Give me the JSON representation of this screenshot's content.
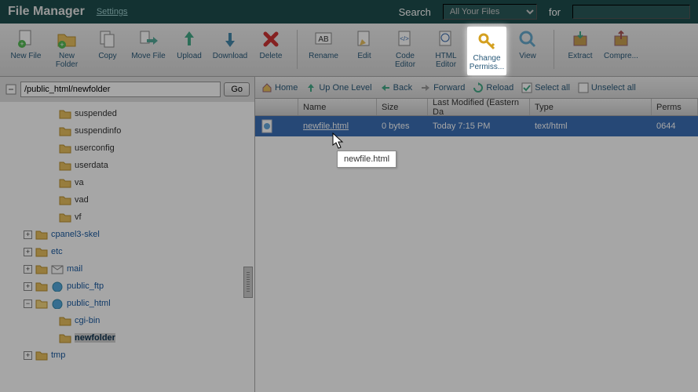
{
  "header": {
    "title": "File Manager",
    "settings": "Settings",
    "searchLabel": "Search",
    "searchScope": "All Your Files",
    "forLabel": "for"
  },
  "toolbar": {
    "newFile": "New File",
    "newFolder": "New Folder",
    "copy": "Copy",
    "moveFile": "Move File",
    "upload": "Upload",
    "download": "Download",
    "delete": "Delete",
    "rename": "Rename",
    "edit": "Edit",
    "codeEditor": "Code Editor",
    "htmlEditor": "HTML Editor",
    "changePerms": "Change Permiss...",
    "view": "View",
    "extract": "Extract",
    "compress": "Compre..."
  },
  "path": {
    "value": "/public_html/newfolder",
    "go": "Go"
  },
  "tree": {
    "suspended": "suspended",
    "suspendinfo": "suspendinfo",
    "userconfig": "userconfig",
    "userdata": "userdata",
    "va": "va",
    "vad": "vad",
    "vf": "vf",
    "cpanel3skel": "cpanel3-skel",
    "etc": "etc",
    "mail": "mail",
    "publicFtp": "public_ftp",
    "publicHtml": "public_html",
    "cgiBin": "cgi-bin",
    "newfolder": "newfolder",
    "tmp": "tmp"
  },
  "nav": {
    "home": "Home",
    "upOne": "Up One Level",
    "back": "Back",
    "forward": "Forward",
    "reload": "Reload",
    "selectAll": "Select all",
    "unselectAll": "Unselect all"
  },
  "columns": {
    "name": "Name",
    "size": "Size",
    "modified": "Last Modified (Eastern Da",
    "type": "Type",
    "perms": "Perms"
  },
  "row": {
    "name": "newfile.html",
    "size": "0 bytes",
    "modified": "Today 7:15 PM",
    "type": "text/html",
    "perms": "0644"
  },
  "tooltip": "newfile.html"
}
